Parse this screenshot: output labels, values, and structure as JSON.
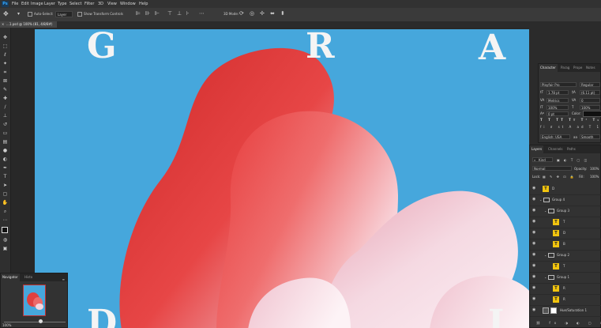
{
  "menubar": {
    "logo": "Ps",
    "items": [
      "File",
      "Edit",
      "Image",
      "Layer",
      "Type",
      "Select",
      "Filter",
      "3D",
      "View",
      "Window",
      "Help"
    ]
  },
  "options": {
    "auto_select": "Auto-Select:",
    "layer_value": "Layer",
    "transform_controls": "Show Transform Controls",
    "mode_3d": "3D Mode:"
  },
  "document": {
    "tab_label": "...1.psd @ 100% (81, 4/8/8#)"
  },
  "canvas_letters": {
    "g": "G",
    "r": "R",
    "a": "A",
    "d": "D",
    "i": "I"
  },
  "character_panel": {
    "tabs": [
      "Character",
      "Parag",
      "Prope",
      "Notes"
    ],
    "font_family": "Playfair Pro",
    "font_style": "Regular",
    "font_size": "1.78 pt",
    "leading": "(6.11 pt)",
    "kerning": "Metrics",
    "tracking": "0",
    "vertical_scale": "100%",
    "horizontal_scale": "100%",
    "baseline": "0 pt",
    "color_label": "Color:",
    "color_value": "#111111",
    "language": "English: USA",
    "antialias": "Smooth"
  },
  "layers_panel": {
    "tabs": [
      "Layers",
      "Channels",
      "Paths"
    ],
    "filter_kind": "Kind",
    "blend_mode": "Normal",
    "opacity_label": "Opacity:",
    "opacity_value": "100%",
    "lock_label": "Lock:",
    "fill_label": "Fill:",
    "fill_value": "100%",
    "rows": [
      {
        "name": "D",
        "type": "text"
      },
      {
        "name": "Group 4",
        "type": "group"
      },
      {
        "name": "Group 3",
        "type": "group"
      },
      {
        "name": "T",
        "type": "text"
      },
      {
        "name": "D",
        "type": "text"
      },
      {
        "name": "B",
        "type": "text"
      },
      {
        "name": "Group 2",
        "type": "group"
      },
      {
        "name": "T",
        "type": "text"
      },
      {
        "name": "Group 1",
        "type": "group"
      },
      {
        "name": "R",
        "type": "text"
      },
      {
        "name": "R",
        "type": "text"
      },
      {
        "name": "Hue/Saturation 1",
        "type": "adjustment"
      }
    ]
  },
  "navigator_panel": {
    "tabs": [
      "Navigator",
      "Histo"
    ]
  },
  "status": {
    "zoom": "100%"
  },
  "colors": {
    "canvas_blue": "#46a7dc",
    "shape_red": "#e23a3a",
    "shape_pink": "#f3dde6",
    "panel_bg": "#323232"
  }
}
